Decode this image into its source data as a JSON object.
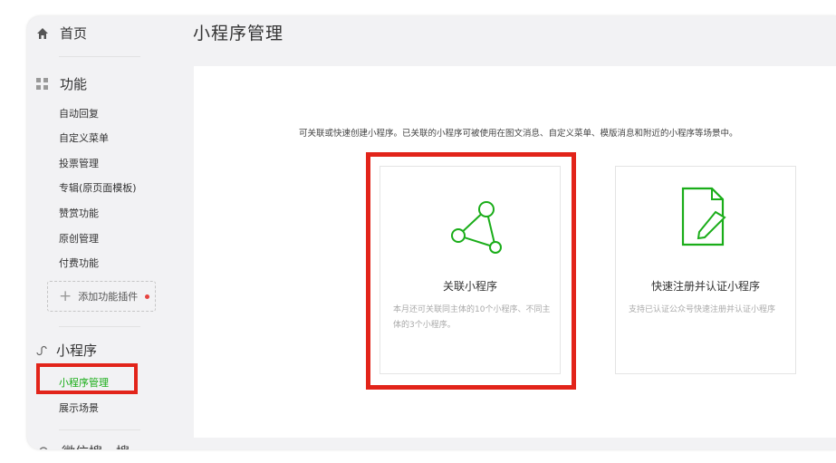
{
  "sidebar": {
    "home": "首页",
    "function_title": "功能",
    "function_items": [
      "自动回复",
      "自定义菜单",
      "投票管理",
      "专辑(原页面模板)",
      "赞赏功能",
      "原创管理",
      "付费功能"
    ],
    "add_plugin": "添加功能插件",
    "miniprogram_title": "小程序",
    "miniprogram_items": [
      "小程序管理",
      "展示场景"
    ],
    "wechat_search": "微信搜一搜"
  },
  "main": {
    "title": "小程序管理",
    "intro": "可关联或快速创建小程序。已关联的小程序可被使用在图文消息、自定义菜单、模版消息和附近的小程序等场景中。",
    "cards": [
      {
        "title": "关联小程序",
        "desc": "本月还可关联同主体的10个小程序、不同主体的3个小程序。"
      },
      {
        "title": "快速注册并认证小程序",
        "desc": "支持已认证公众号快速注册并认证小程序"
      }
    ]
  },
  "colors": {
    "accent": "#1aad19",
    "annotation": "#e2241a",
    "notice": "#e64340"
  },
  "icons": [
    "home-icon",
    "grid-icon",
    "miniprogram-icon",
    "share-nodes-icon",
    "document-edit-icon",
    "search-icon"
  ]
}
